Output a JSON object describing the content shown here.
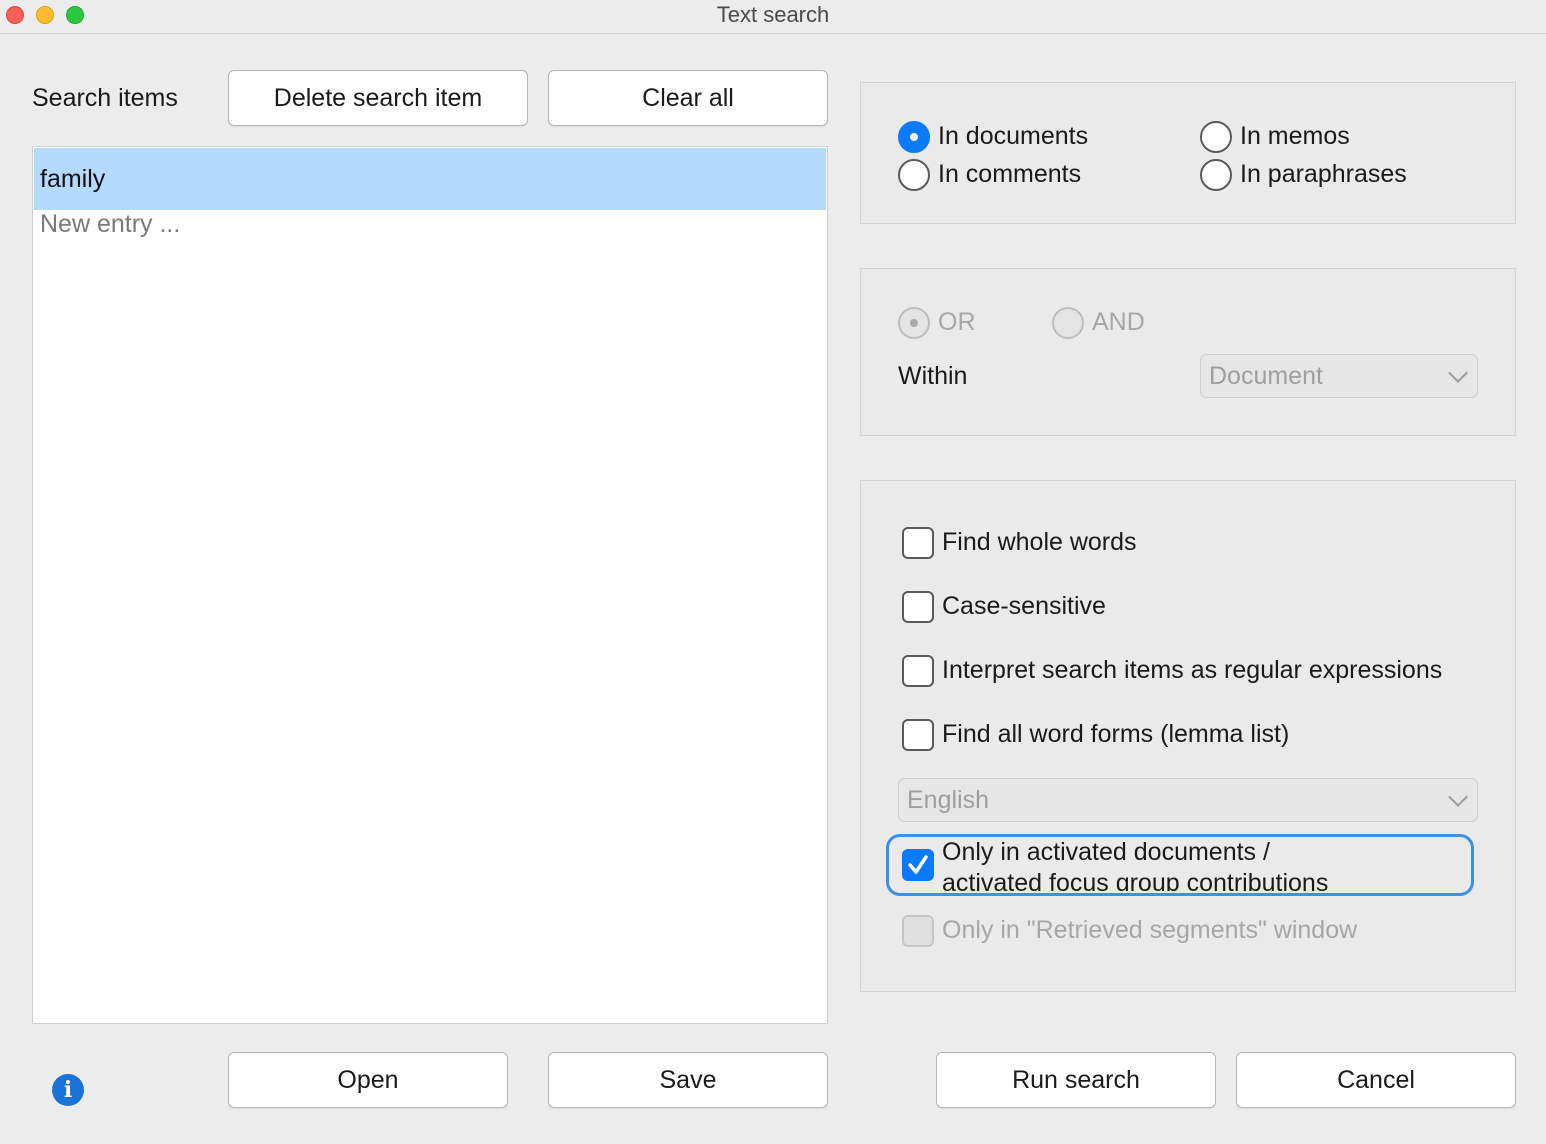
{
  "window": {
    "title": "Text search"
  },
  "left": {
    "search_items_label": "Search items",
    "delete_button": "Delete search item",
    "clear_button": "Clear all",
    "items": [
      "family"
    ],
    "new_entry_placeholder": "New entry ...",
    "open_button": "Open",
    "save_button": "Save"
  },
  "scope": {
    "in_documents": "In documents",
    "in_memos": "In memos",
    "in_comments": "In comments",
    "in_paraphrases": "In paraphrases",
    "selected": "In documents"
  },
  "logic": {
    "or_label": "OR",
    "and_label": "AND",
    "selected": "OR",
    "within_label": "Within",
    "within_value": "Document"
  },
  "options": {
    "whole_words": "Find whole words",
    "case_sensitive": "Case-sensitive",
    "regex": "Interpret search items as regular expressions",
    "lemma": "Find all word forms (lemma list)",
    "language": "English",
    "activated_line1": "Only in activated documents /",
    "activated_line2": "activated focus group contributions",
    "retrieved": "Only in \"Retrieved segments\" window"
  },
  "footer": {
    "run_button": "Run search",
    "cancel_button": "Cancel"
  },
  "colors": {
    "accent": "#0a7afe",
    "selection": "#b4dbff",
    "info": "#1a73d9"
  }
}
